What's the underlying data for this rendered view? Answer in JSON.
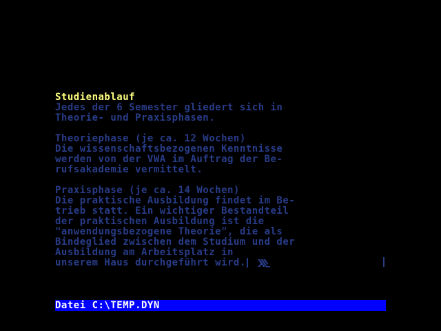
{
  "document": {
    "heading": "Studienablauf",
    "paragraph1": [
      "Jedes der 6 Semester gliedert sich in",
      "Theorie- und Praxisphasen."
    ],
    "paragraph2": [
      "Theoriephase (je ca. 12 Wochen)",
      "Die wissenschaftsbezogenen Kenntnisse",
      "werden von der VWA im Auftrag der Be-",
      "rufsakademie vermittelt."
    ],
    "paragraph3": [
      "Praxisphase (je ca. 14 Wochen)",
      "Die praktische Ausbildung findet im Be-",
      "trieb statt. Ein wichtiger Bestandteil",
      "der praktischen Ausbildung ist die",
      "\"anwendungsbezogene Theorie\", die als",
      "Bindeglied zwischen dem Studium und der",
      "Ausbildung am Arbeitsplatz in",
      "unserem Haus durchgeführt wird."
    ]
  },
  "status_bar": {
    "label": "Datei C:\\TEMP.DYN"
  },
  "colors": {
    "background": "#000000",
    "heading": "#ffff80",
    "body_text": "#283c88",
    "status_bg": "#0000ff",
    "status_text": "#ffffff"
  },
  "icons": {
    "logo": "vwa-logo-icon"
  }
}
